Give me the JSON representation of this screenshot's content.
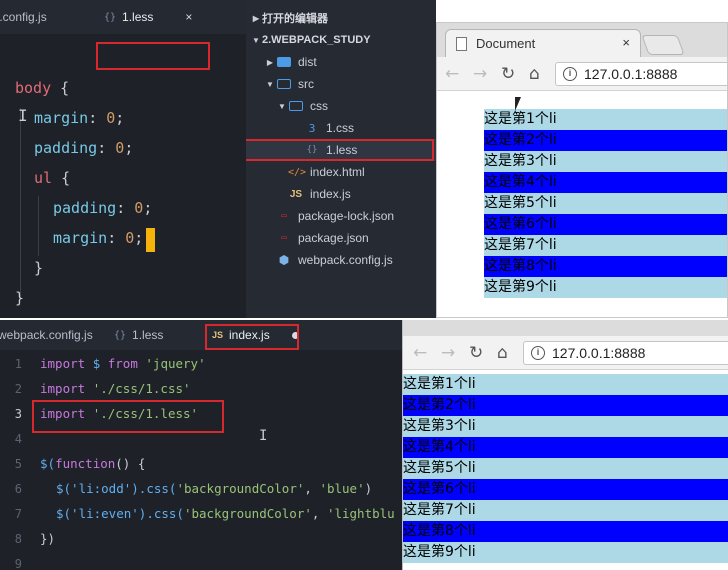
{
  "less_editor": {
    "tabs": [
      {
        "label": "r.config.js"
      },
      {
        "label": "1.less",
        "close": "×"
      }
    ],
    "code": {
      "body": "body",
      "open": "{",
      "close": "}",
      "margin": "margin",
      "padding": "padding",
      "ul": "ul",
      "zero": "0",
      "colon": ":",
      "semicolon": ";"
    }
  },
  "explorer": {
    "open_editors": "打开的编辑器",
    "project": "2.WEBPACK_STUDY",
    "items": [
      {
        "label": "dist"
      },
      {
        "label": "src"
      },
      {
        "label": "css"
      },
      {
        "label": "1.css"
      },
      {
        "label": "1.less"
      },
      {
        "label": "index.html"
      },
      {
        "label": "index.js"
      },
      {
        "label": "package-lock.json"
      },
      {
        "label": "package.json"
      },
      {
        "label": "webpack.config.js"
      }
    ]
  },
  "browser_top": {
    "tab_title": "Document",
    "close": "×",
    "url": "127.0.0.1:8888"
  },
  "browser_bottom": {
    "url": "127.0.0.1:8888"
  },
  "list_items": [
    "这是第1个li",
    "这是第2个li",
    "这是第3个li",
    "这是第4个li",
    "这是第5个li",
    "这是第6个li",
    "这是第7个li",
    "这是第8个li",
    "这是第9个li"
  ],
  "colors": {
    "odd_bg": "#0000ff",
    "even_bg": "#add8e6"
  },
  "js_editor": {
    "tabs": [
      {
        "label": "webpack.config.js"
      },
      {
        "label": "1.less"
      },
      {
        "label": "index.js"
      }
    ],
    "line_numbers": [
      "1",
      "2",
      "3",
      "4",
      "5",
      "6",
      "7",
      "8",
      "9"
    ],
    "code": {
      "import_kw": "import",
      "dollar": "$",
      "from_kw": "from",
      "jquery": "'jquery'",
      "css_path": "'./css/1.css'",
      "less_path": "'./css/1.less'",
      "l5_a": "$(",
      "l5_fn": "function",
      "l5_b": "() {",
      "sel_odd": "$('li:odd')",
      "sel_even": "$('li:even')",
      "css_call": ".css(",
      "bg_prop": "'backgroundColor'",
      "comma": ", ",
      "val_blue": "'blue'",
      "val_light": "'lightblu",
      "paren_close": ")",
      "l8": "})"
    }
  }
}
